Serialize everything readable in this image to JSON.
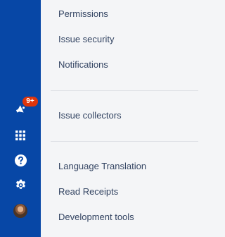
{
  "global_nav": {
    "background": "#0747a6",
    "notifications": {
      "icon": "megaphone-icon",
      "badge": "9+",
      "badge_color": "#de350b"
    },
    "app_switcher": {
      "icon": "app-switcher-icon"
    },
    "help": {
      "icon": "help-icon"
    },
    "settings": {
      "icon": "gear-icon"
    },
    "profile": {
      "icon": "avatar"
    }
  },
  "menu": {
    "group1": [
      {
        "label": "Permissions"
      },
      {
        "label": "Issue security"
      },
      {
        "label": "Notifications"
      }
    ],
    "group2": [
      {
        "label": "Issue collectors"
      }
    ],
    "group3": [
      {
        "label": "Language Translation"
      },
      {
        "label": "Read Receipts"
      },
      {
        "label": "Development tools"
      }
    ]
  }
}
